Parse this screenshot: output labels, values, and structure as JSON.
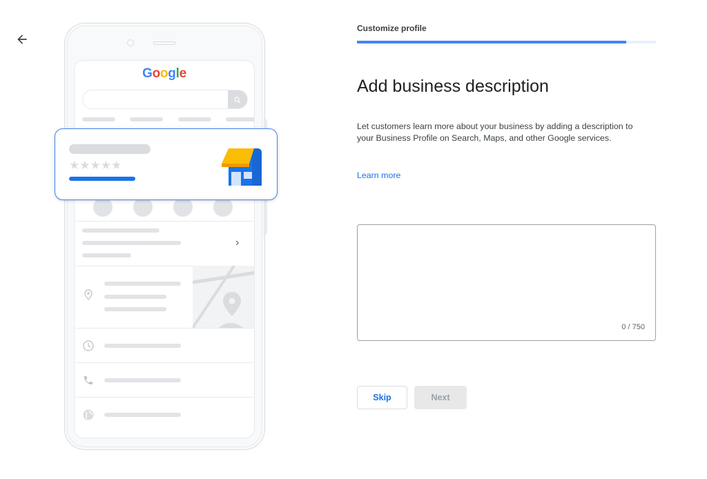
{
  "nav": {
    "back_icon": "arrow-left-icon"
  },
  "illustration": {
    "logo_letters": [
      "G",
      "o",
      "o",
      "g",
      "l",
      "e"
    ],
    "card_stars": "★★★★★",
    "list_chevron": "›",
    "icons": [
      "search-icon",
      "phone-icon",
      "directions-icon",
      "bookmark-icon",
      "globe-icon",
      "location-pin-icon",
      "clock-icon",
      "storefront-icon"
    ]
  },
  "step": {
    "label": "Customize profile",
    "progress_percent": 90
  },
  "main": {
    "title": "Add business description",
    "description": "Let customers learn more about your business by adding a description to your Business Profile on Search, Maps, and other Google services.",
    "learn_more": "Learn more",
    "textarea_value": "",
    "textarea_placeholder": "",
    "char_count": "0 / 750"
  },
  "actions": {
    "skip_label": "Skip",
    "next_label": "Next"
  },
  "colors": {
    "accent": "#1a73e8",
    "progress": "#4285f4",
    "progress_track": "#e8f0fe",
    "awning": "#fbbc04"
  }
}
